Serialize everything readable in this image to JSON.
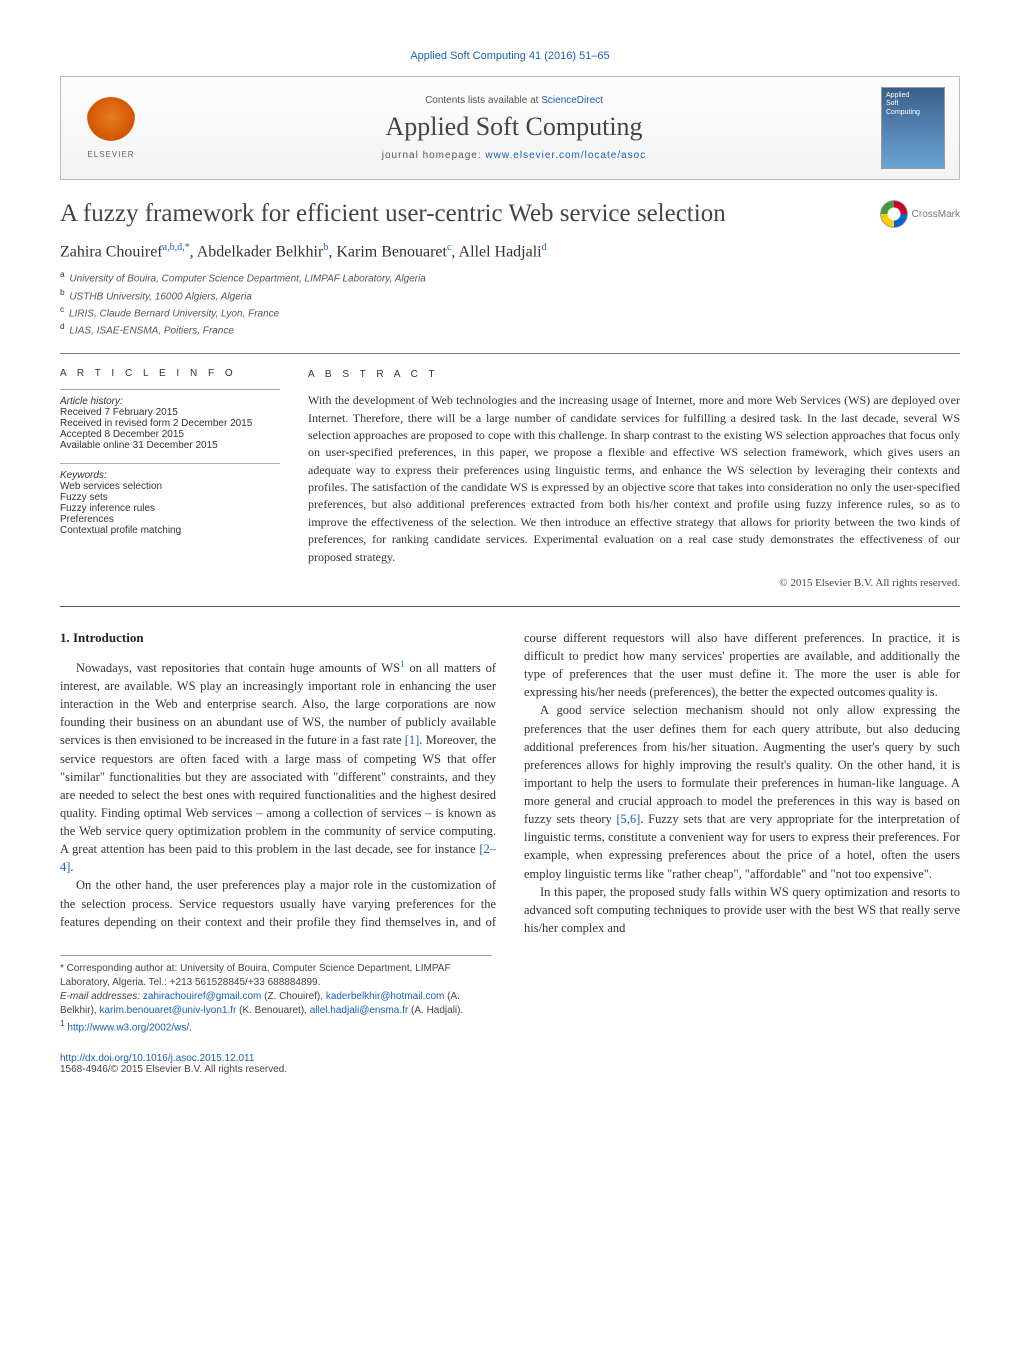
{
  "citation": "Applied Soft Computing 41 (2016) 51–65",
  "header": {
    "contents_prefix": "Contents lists available at ",
    "contents_link": "ScienceDirect",
    "journal": "Applied Soft Computing",
    "homepage_prefix": "journal homepage: ",
    "homepage_url": "www.elsevier.com/locate/asoc",
    "elsevier": "ELSEVIER",
    "cover_line1": "Applied",
    "cover_line2": "Soft",
    "cover_line3": "Computing"
  },
  "article": {
    "title": "A fuzzy framework for efficient user-centric Web service selection",
    "crossmark": "CrossMark",
    "authors_html": "Zahira Chouiref",
    "authors": [
      {
        "name": "Zahira Chouiref",
        "marks": "a,b,d,*"
      },
      {
        "name": "Abdelkader Belkhir",
        "marks": "b"
      },
      {
        "name": "Karim Benouaret",
        "marks": "c"
      },
      {
        "name": "Allel Hadjali",
        "marks": "d"
      }
    ],
    "affiliations": [
      {
        "mark": "a",
        "text": "University of Bouira, Computer Science Department, LIMPAF Laboratory, Algeria"
      },
      {
        "mark": "b",
        "text": "USTHB University, 16000 Algiers, Algeria"
      },
      {
        "mark": "c",
        "text": "LIRIS, Claude Bernard University, Lyon, France"
      },
      {
        "mark": "d",
        "text": "LIAS, ISAE-ENSMA, Poitiers, France"
      }
    ]
  },
  "info": {
    "heading": "A R T I C L E   I N F O",
    "history_label": "Article history:",
    "history": [
      "Received 7 February 2015",
      "Received in revised form 2 December 2015",
      "Accepted 8 December 2015",
      "Available online 31 December 2015"
    ],
    "keywords_label": "Keywords:",
    "keywords": [
      "Web services selection",
      "Fuzzy sets",
      "Fuzzy inference rules",
      "Preferences",
      "Contextual profile matching"
    ]
  },
  "abstract": {
    "heading": "A B S T R A C T",
    "text": "With the development of Web technologies and the increasing usage of Internet, more and more Web Services (WS) are deployed over Internet. Therefore, there will be a large number of candidate services for fulfilling a desired task. In the last decade, several WS selection approaches are proposed to cope with this challenge. In sharp contrast to the existing WS selection approaches that focus only on user-specified preferences, in this paper, we propose a flexible and effective WS selection framework, which gives users an adequate way to express their preferences using linguistic terms, and enhance the WS selection by leveraging their contexts and profiles. The satisfaction of the candidate WS is expressed by an objective score that takes into consideration no only the user-specified preferences, but also additional preferences extracted from both his/her context and profile using fuzzy inference rules, so as to improve the effectiveness of the selection. We then introduce an effective strategy that allows for priority between the two kinds of preferences, for ranking candidate services. Experimental evaluation on a real case study demonstrates the effectiveness of our proposed strategy.",
    "copyright": "© 2015 Elsevier B.V. All rights reserved."
  },
  "body": {
    "section_heading": "1.  Introduction",
    "p1": "Nowadays, vast repositories that contain huge amounts of WS¹ on all matters of interest, are available. WS play an increasingly important role in enhancing the user interaction in the Web and enterprise search. Also, the large corporations are now founding their business on an abundant use of WS, the number of publicly available services is then envisioned to be increased in the future in a fast rate [1]. Moreover, the service requestors are often faced with a large mass of competing WS that offer \"similar\" functionalities but they are associated with \"different\" constraints, and they are needed to select the best ones with required functionalities and the highest desired quality. Finding optimal Web services – among a collection of services – is known as the Web service query optimization problem in the community of service computing. A great attention has been paid to this problem in the last decade, see for instance [2–4].",
    "p2": "On the other hand, the user preferences play a major role in the customization of the selection process. Service requestors usually have varying preferences for the features depending on their context and their profile they find themselves in, and of course different requestors will also have different preferences. In practice, it is difficult to predict how many services' properties are available, and additionally the type of preferences that the user must define it. The more the user is able for expressing his/her needs (preferences), the better the expected outcomes quality is.",
    "p3": "A good service selection mechanism should not only allow expressing the preferences that the user defines them for each query attribute, but also deducing additional preferences from his/her situation. Augmenting the user's query by such preferences allows for highly improving the result's quality. On the other hand, it is important to help the users to formulate their preferences in human-like language. A more general and crucial approach to model the preferences in this way is based on fuzzy sets theory [5,6]. Fuzzy sets that are very appropriate for the interpretation of linguistic terms, constitute a convenient way for users to express their preferences. For example, when expressing preferences about the price of a hotel, often the users employ linguistic terms like \"rather cheap\", \"affordable\" and \"not too expensive\".",
    "p4": "In this paper, the proposed study falls within WS query optimization and resorts to advanced soft computing techniques to provide user with the best WS that really serve his/her complex and"
  },
  "footnotes": {
    "corr": "* Corresponding author at: University of Bouira, Computer Science Department, LIMPAF Laboratory, Algeria. Tel.: +213 561528845/+33 688884899.",
    "email_label": "E-mail addresses:",
    "emails": [
      {
        "addr": "zahirachouiref@gmail.com",
        "who": "(Z. Chouiref),"
      },
      {
        "addr": "kaderbelkhir@hotmail.com",
        "who": "(A. Belkhir),"
      },
      {
        "addr": "karim.benouaret@univ-lyon1.fr",
        "who": "(K. Benouaret),"
      },
      {
        "addr": "allel.hadjali@ensma.fr",
        "who": "(A. Hadjali)."
      }
    ],
    "fn1_mark": "1",
    "fn1_url": "http://www.w3.org/2002/ws/",
    "fn1_tail": "."
  },
  "doi": {
    "url": "http://dx.doi.org/10.1016/j.asoc.2015.12.011",
    "issn_line": "1568-4946/© 2015 Elsevier B.V. All rights reserved."
  }
}
